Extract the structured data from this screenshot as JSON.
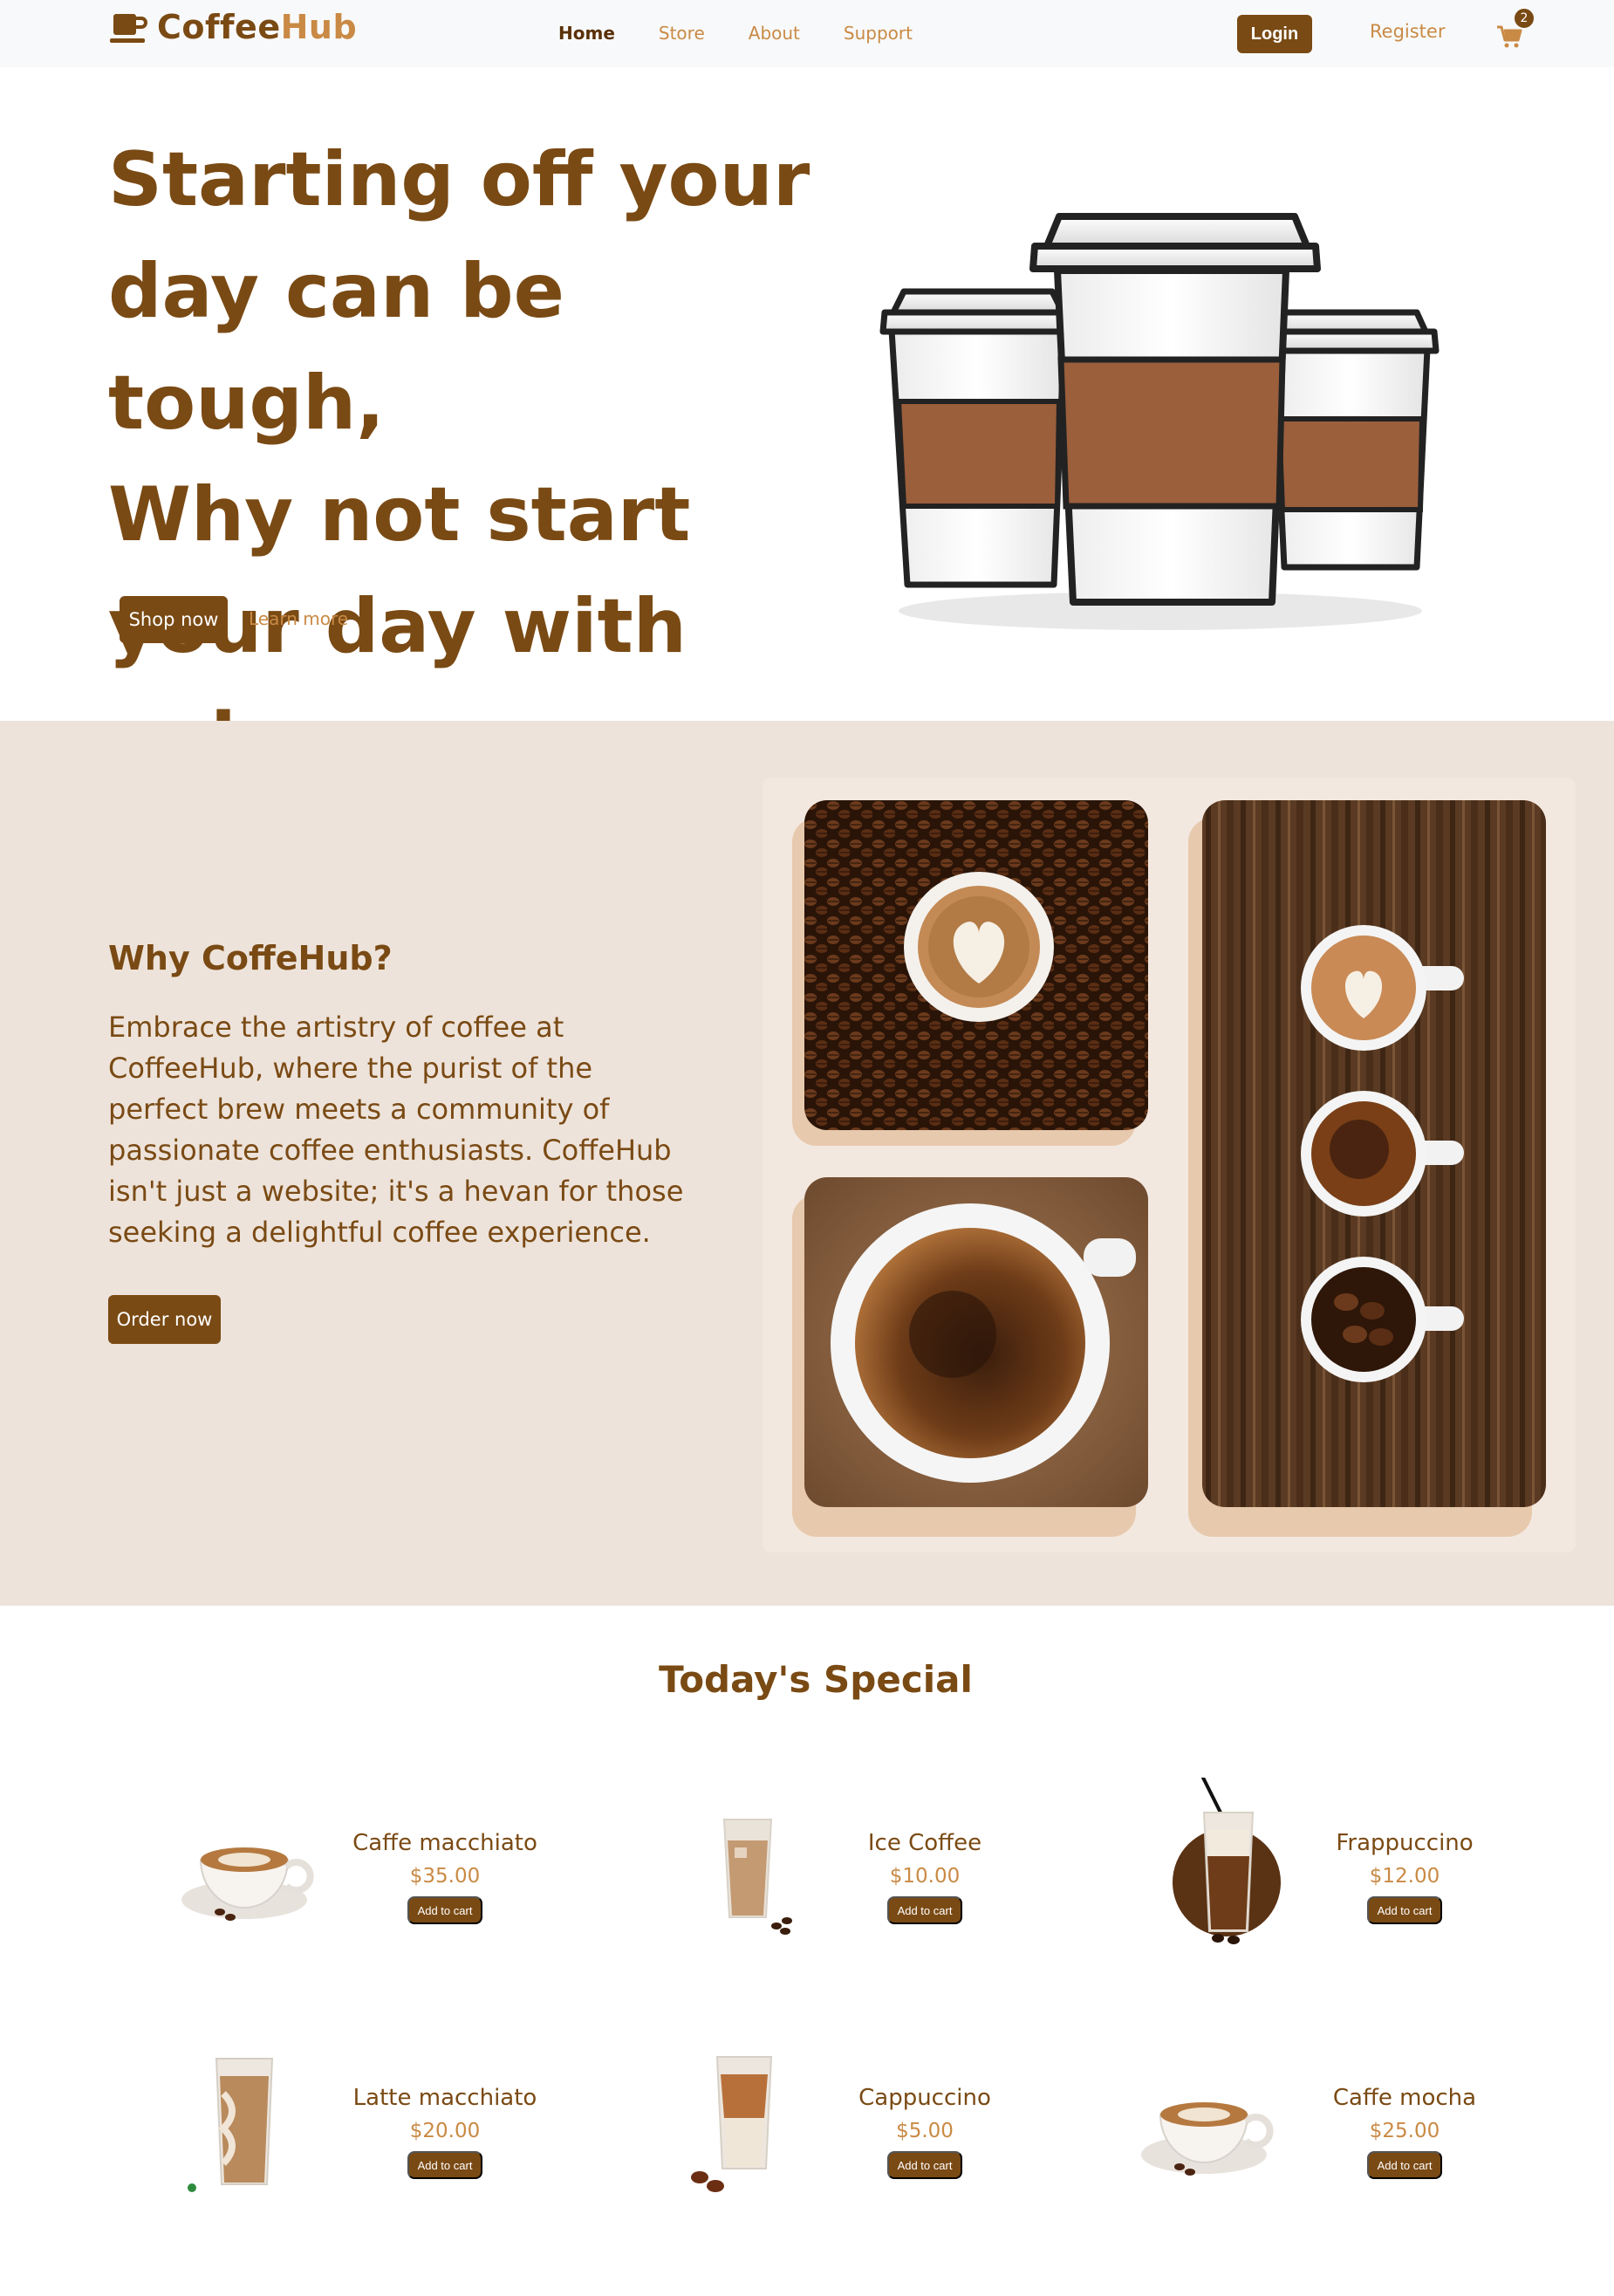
{
  "nav": {
    "logo_part1": "Coffee",
    "logo_part2": "Hub",
    "links": [
      {
        "label": "Home",
        "active": true
      },
      {
        "label": "Store",
        "active": false
      },
      {
        "label": "About",
        "active": false
      },
      {
        "label": "Support",
        "active": false
      }
    ],
    "login_label": "Login",
    "register_label": "Register",
    "cart_count": "2"
  },
  "hero": {
    "title_lines": [
      "Starting off your",
      "day can be tough,",
      "Why not start",
      "your day with us!"
    ],
    "shop_now_label": "Shop now",
    "learn_more_label": "Learn more"
  },
  "why": {
    "heading": "Why CoffeHub?",
    "text": "Embrace the artistry of coffee at CoffeeHub, where the purist of the perfect brew meets a community of passionate coffee enthusiasts. CoffeHub isn't just a website; it's a hevan for those seeking a delightful coffee experience.",
    "order_now_label": "Order now"
  },
  "special": {
    "title": "Today's Special",
    "add_to_cart_label": "Add to cart",
    "items": [
      {
        "name": "Caffe macchiato",
        "price": "$35.00",
        "icon": "cup-saucer"
      },
      {
        "name": "Ice Coffee",
        "price": "$10.00",
        "icon": "iced-glass"
      },
      {
        "name": "Frappuccino",
        "price": "$12.00",
        "icon": "tall-glass-straw"
      },
      {
        "name": "Latte macchiato",
        "price": "$20.00",
        "icon": "tall-glass"
      },
      {
        "name": "Cappuccino",
        "price": "$5.00",
        "icon": "iced-glass"
      },
      {
        "name": "Caffe mocha",
        "price": "$25.00",
        "icon": "cup-saucer"
      }
    ]
  },
  "colors": {
    "brand_dark": "#7a4a14",
    "brand_light": "#c98a45",
    "section_bg": "#ede3da"
  }
}
